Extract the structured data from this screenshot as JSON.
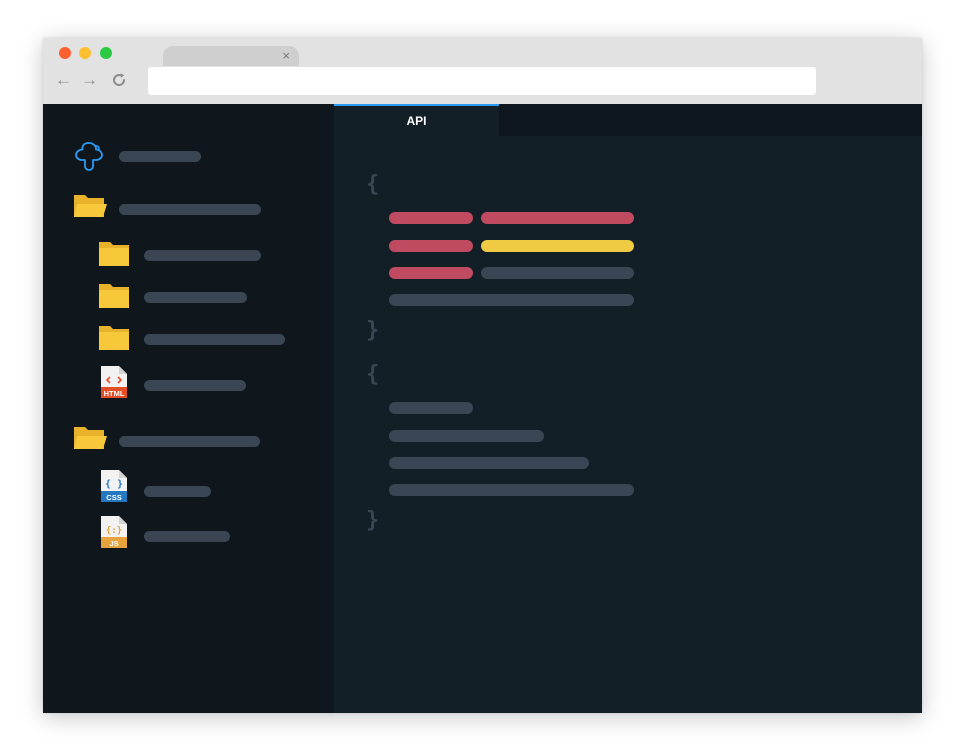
{
  "browser": {
    "tab_close_glyph": "×",
    "nav": {
      "back_glyph": "←",
      "forward_glyph": "→",
      "reload_glyph": "⟳"
    },
    "address_value": ""
  },
  "sidebar": {
    "root_icon": "cloud-icon",
    "items": [
      {
        "icon": "folder-open-icon",
        "level": 0
      },
      {
        "icon": "folder-icon",
        "level": 1
      },
      {
        "icon": "folder-icon",
        "level": 1
      },
      {
        "icon": "folder-icon",
        "level": 1
      },
      {
        "icon": "html-file-icon",
        "level": 1,
        "badge": "HTML"
      },
      {
        "icon": "folder-open-icon",
        "level": 0
      },
      {
        "icon": "css-file-icon",
        "level": 1,
        "badge": "CSS"
      },
      {
        "icon": "js-file-icon",
        "level": 1,
        "badge": "JS"
      }
    ]
  },
  "editor": {
    "active_tab": "API",
    "brace_open": "{",
    "brace_close": "}"
  },
  "colors": {
    "key": "#c04a60",
    "string": "#eecb43",
    "muted": "#3a4654",
    "accent": "#2b9af3",
    "folder": "#f7c93a",
    "folder_dark": "#e8b32a",
    "html_badge": "#e44d26",
    "css_badge": "#2478c2",
    "js_badge": "#e7a33c"
  }
}
